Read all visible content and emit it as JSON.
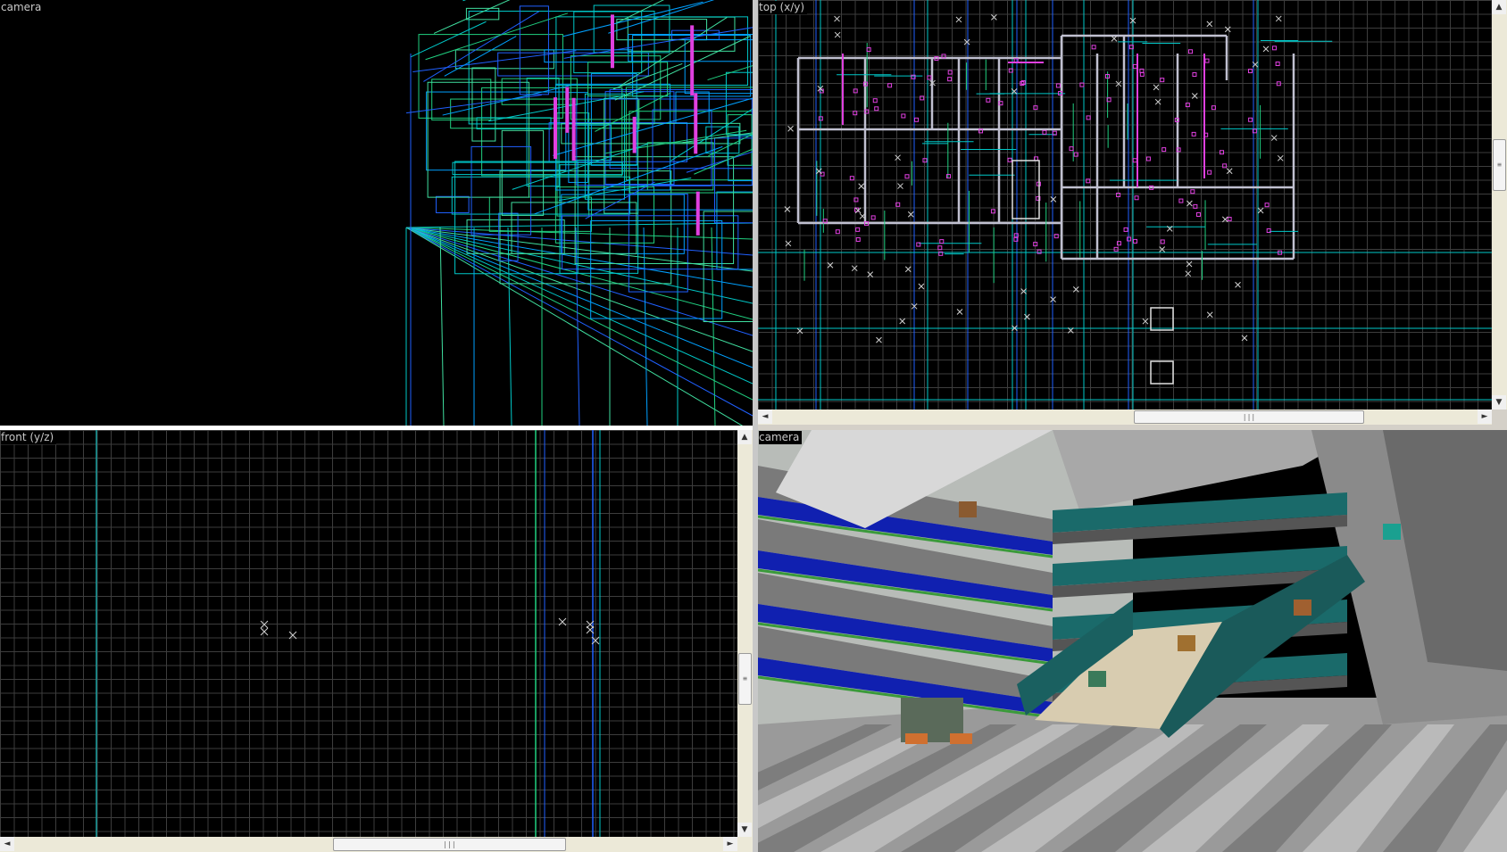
{
  "app": {
    "viewports": {
      "camera_wire": {
        "label": "camera"
      },
      "top": {
        "label": "top (x/y)"
      },
      "front": {
        "label": "front (y/z)"
      },
      "camera_tex": {
        "label": "camera"
      }
    }
  },
  "icons": {
    "scroll_left": "◄",
    "scroll_right": "►",
    "scroll_up": "▲",
    "scroll_down": "▼",
    "thumb_grip": "|||"
  },
  "colors": {
    "grid": "#3d3d3d",
    "brush_cyan": "#00c8c8",
    "brush_green": "#20d080",
    "brush_blue": "#2060ff",
    "entity_magenta": "#e040e0",
    "entity_white": "#d0d0d0"
  }
}
